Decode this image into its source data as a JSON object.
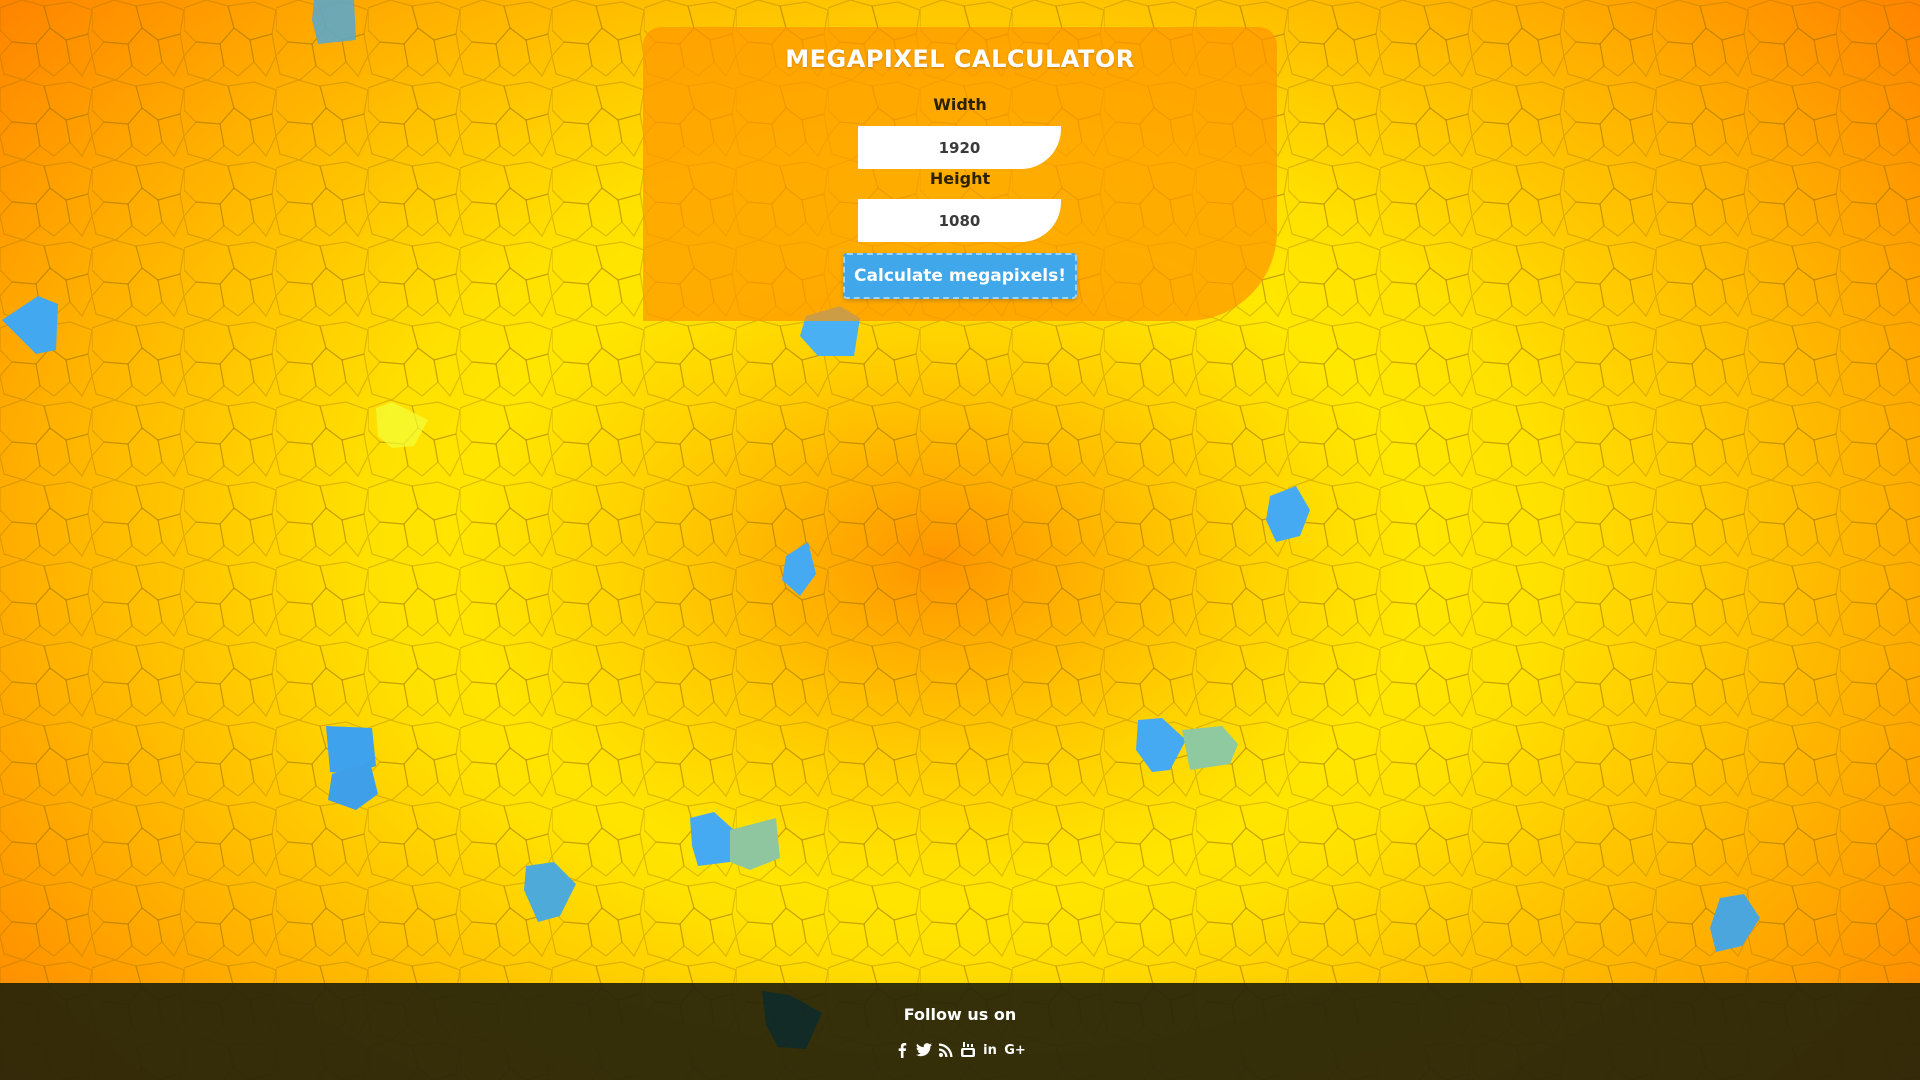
{
  "calculator": {
    "title": "MEGAPIXEL CALCULATOR",
    "width_label": "Width",
    "width_value": "1920",
    "height_label": "Height",
    "height_value": "1080",
    "submit_label": "Calculate megapixels!"
  },
  "footer": {
    "follow_text": "Follow us on",
    "social": [
      {
        "name": "facebook",
        "icon": "facebook-icon"
      },
      {
        "name": "twitter",
        "icon": "twitter-icon"
      },
      {
        "name": "rss",
        "icon": "rss-icon"
      },
      {
        "name": "youtube",
        "icon": "youtube-icon"
      },
      {
        "name": "linkedin",
        "icon": "linkedin-icon",
        "glyph": "in"
      },
      {
        "name": "google-plus",
        "icon": "google-plus-icon",
        "glyph": "G+"
      }
    ]
  },
  "colors": {
    "background_center": "#ffff00",
    "background_edge": "#ff7a00",
    "panel": "#ff9600",
    "button": "#3fa7ea",
    "footer": "#26240a",
    "tile_accent": "#4aa8f0"
  }
}
